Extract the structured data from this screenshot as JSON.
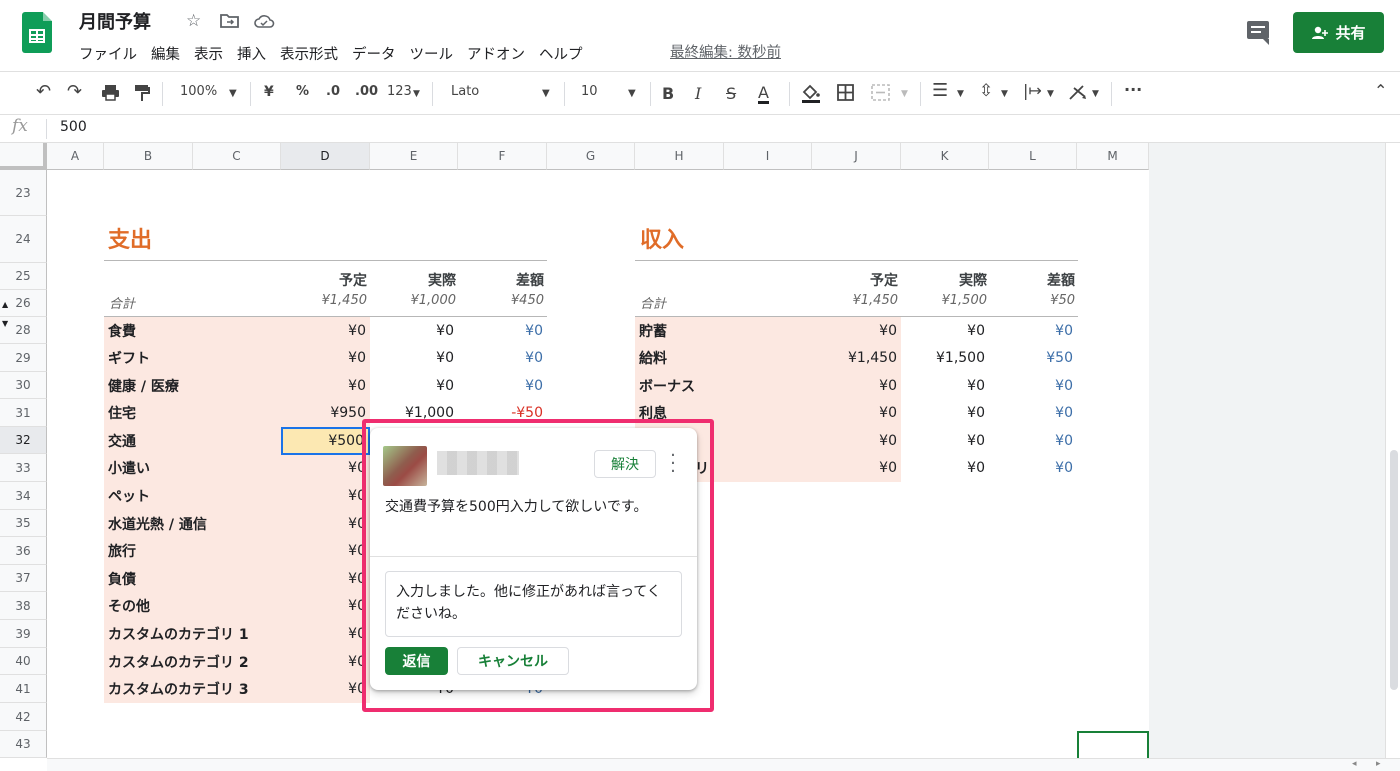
{
  "doc": {
    "title": "月間予算",
    "last_edit": "最終編集: 数秒前"
  },
  "menu": [
    "ファイル",
    "編集",
    "表示",
    "挿入",
    "表示形式",
    "データ",
    "ツール",
    "アドオン",
    "ヘルプ"
  ],
  "share_label": "共有",
  "toolbar": {
    "zoom": "100%",
    "currency": "¥",
    "percent": "%",
    "dec_less": ".0",
    "dec_more": ".00",
    "more_formats": "123",
    "font": "Lato",
    "font_size": "10"
  },
  "formula": {
    "value": "500"
  },
  "columns": [
    "A",
    "B",
    "C",
    "D",
    "E",
    "F",
    "G",
    "H",
    "I",
    "J",
    "K",
    "L",
    "M"
  ],
  "rows": [
    "23",
    "24",
    "25",
    "26",
    "28",
    "29",
    "30",
    "31",
    "32",
    "33",
    "34",
    "35",
    "36",
    "37",
    "38",
    "39",
    "40",
    "41",
    "42",
    "43"
  ],
  "expenses": {
    "title": "支出",
    "headers": {
      "plan": "予定",
      "actual": "実際",
      "diff": "差額"
    },
    "totals": {
      "label": "合計",
      "plan": "¥1,450",
      "actual": "¥1,000",
      "diff": "¥450"
    },
    "items": [
      {
        "label": "食費",
        "plan": "¥0",
        "actual": "¥0",
        "diff": "¥0"
      },
      {
        "label": "ギフト",
        "plan": "¥0",
        "actual": "¥0",
        "diff": "¥0"
      },
      {
        "label": "健康 / 医療",
        "plan": "¥0",
        "actual": "¥0",
        "diff": "¥0"
      },
      {
        "label": "住宅",
        "plan": "¥950",
        "actual": "¥1,000",
        "diff": "-¥50"
      },
      {
        "label": "交通",
        "plan": "¥500",
        "actual": "",
        "diff": ""
      },
      {
        "label": "小遣い",
        "plan": "¥0",
        "actual": "",
        "diff": ""
      },
      {
        "label": "ペット",
        "plan": "¥0",
        "actual": "",
        "diff": ""
      },
      {
        "label": "水道光熱 / 通信",
        "plan": "¥0",
        "actual": "",
        "diff": ""
      },
      {
        "label": "旅行",
        "plan": "¥0",
        "actual": "",
        "diff": ""
      },
      {
        "label": "負債",
        "plan": "¥0",
        "actual": "",
        "diff": ""
      },
      {
        "label": "その他",
        "plan": "¥0",
        "actual": "",
        "diff": ""
      },
      {
        "label": "カスタムのカテゴリ 1",
        "plan": "¥0",
        "actual": "",
        "diff": ""
      },
      {
        "label": "カスタムのカテゴリ 2",
        "plan": "¥0",
        "actual": "",
        "diff": ""
      },
      {
        "label": "カスタムのカテゴリ 3",
        "plan": "¥0",
        "actual": "¥0",
        "diff": "¥0"
      }
    ]
  },
  "income": {
    "title": "収入",
    "headers": {
      "plan": "予定",
      "actual": "実際",
      "diff": "差額"
    },
    "totals": {
      "label": "合計",
      "plan": "¥1,450",
      "actual": "¥1,500",
      "diff": "¥50"
    },
    "items": [
      {
        "label": "貯蓄",
        "plan": "¥0",
        "actual": "¥0",
        "diff": "¥0"
      },
      {
        "label": "給料",
        "plan": "¥1,450",
        "actual": "¥1,500",
        "diff": "¥50"
      },
      {
        "label": "ボーナス",
        "plan": "¥0",
        "actual": "¥0",
        "diff": "¥0"
      },
      {
        "label": "利息",
        "plan": "¥0",
        "actual": "¥0",
        "diff": "¥0"
      },
      {
        "label": "",
        "plan": "¥0",
        "actual": "¥0",
        "diff": "¥0"
      },
      {
        "label": "のカテゴリ",
        "plan": "¥0",
        "actual": "¥0",
        "diff": "¥0"
      }
    ]
  },
  "comment": {
    "resolve_label": "解決",
    "text": "交通費予算を500円入力して欲しいです。",
    "reply_text": "入力しました。他に修正があれば言ってくださいね。",
    "reply_button": "返信",
    "cancel_button": "キャンセル"
  },
  "colors": {
    "accent": "#188038",
    "section_title": "#e06c28",
    "highlight": "#ef2d6f",
    "pink_fill": "#fce8e1",
    "negative": "#d93025"
  }
}
